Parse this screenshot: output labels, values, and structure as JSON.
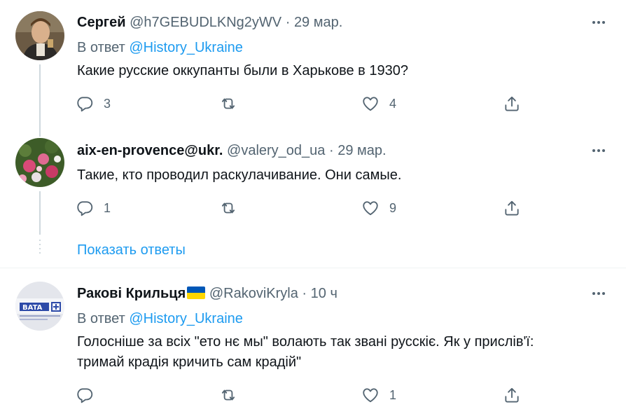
{
  "tweets": [
    {
      "name": "Сергей",
      "handle": "@h7GEBUDLKNg2yWV",
      "time": "29 мар.",
      "reply_prefix": "В ответ",
      "reply_to": "@History_Ukraine",
      "text": "Какие русские оккупанты были в Харькове в 1930?",
      "replies": "3",
      "retweets": "",
      "likes": "4"
    },
    {
      "name": "aix-en-provence@ukr.",
      "handle": "@valery_od_ua",
      "time": "29 мар.",
      "text": "Такие, кто проводил раскулачивание. Они самые.",
      "replies": "1",
      "retweets": "",
      "likes": "9"
    },
    {
      "name": "Ракові Крильця",
      "handle": "@RakoviKryla",
      "time": "10 ч",
      "reply_prefix": "В ответ",
      "reply_to": "@History_Ukraine",
      "text_line1": "Голосніше за всіх \"ето нє мы\" волають так звані русскіє. Як у прислів'ї:",
      "text_line2": "тримай крадія кричить сам крадій\"",
      "replies": "",
      "retweets": "",
      "likes": "1"
    }
  ],
  "show_replies": "Показать ответы",
  "dot_separator": "·",
  "colors": {
    "accent": "#1d9bf0",
    "secondary": "#536471",
    "text": "#0f1419"
  },
  "icons": [
    "reply-icon",
    "retweet-icon",
    "like-icon",
    "share-icon",
    "more-icon",
    "ukraine-flag-icon"
  ]
}
